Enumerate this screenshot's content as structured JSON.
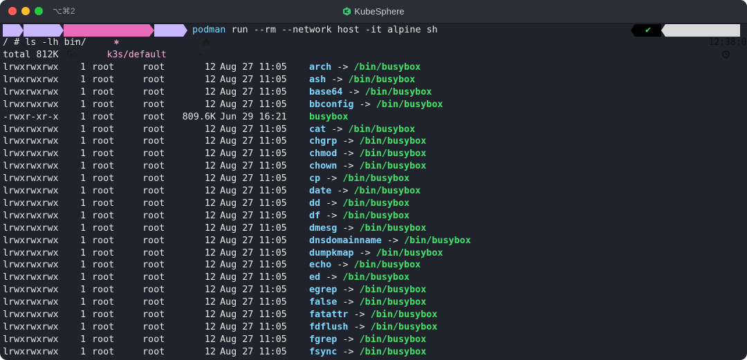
{
  "window": {
    "shortcut": "⌥⌘2",
    "title": "KubeSphere"
  },
  "prompt": {
    "apple_icon": "apple-icon",
    "go_label": "Go",
    "k8s_context": "k3s/default",
    "dir_label": "~",
    "command_bin": "podman",
    "command_args": "run --rm --network host -it alpine sh",
    "status": "✔",
    "time": "12:38:09"
  },
  "shell": {
    "line1": "/ # ls -lh bin/",
    "line2": "total 812K"
  },
  "listing": [
    {
      "perm": "lrwxrwxrwx",
      "links": "1",
      "owner": "root",
      "group": "root",
      "size": "12",
      "date": "Aug 27 11:05",
      "name": "arch",
      "target": "/bin/busybox"
    },
    {
      "perm": "lrwxrwxrwx",
      "links": "1",
      "owner": "root",
      "group": "root",
      "size": "12",
      "date": "Aug 27 11:05",
      "name": "ash",
      "target": "/bin/busybox"
    },
    {
      "perm": "lrwxrwxrwx",
      "links": "1",
      "owner": "root",
      "group": "root",
      "size": "12",
      "date": "Aug 27 11:05",
      "name": "base64",
      "target": "/bin/busybox"
    },
    {
      "perm": "lrwxrwxrwx",
      "links": "1",
      "owner": "root",
      "group": "root",
      "size": "12",
      "date": "Aug 27 11:05",
      "name": "bbconfig",
      "target": "/bin/busybox"
    },
    {
      "perm": "-rwxr-xr-x",
      "links": "1",
      "owner": "root",
      "group": "root",
      "size": "809.6K",
      "date": "Jun 29 16:21",
      "name": "busybox",
      "target": ""
    },
    {
      "perm": "lrwxrwxrwx",
      "links": "1",
      "owner": "root",
      "group": "root",
      "size": "12",
      "date": "Aug 27 11:05",
      "name": "cat",
      "target": "/bin/busybox"
    },
    {
      "perm": "lrwxrwxrwx",
      "links": "1",
      "owner": "root",
      "group": "root",
      "size": "12",
      "date": "Aug 27 11:05",
      "name": "chgrp",
      "target": "/bin/busybox"
    },
    {
      "perm": "lrwxrwxrwx",
      "links": "1",
      "owner": "root",
      "group": "root",
      "size": "12",
      "date": "Aug 27 11:05",
      "name": "chmod",
      "target": "/bin/busybox"
    },
    {
      "perm": "lrwxrwxrwx",
      "links": "1",
      "owner": "root",
      "group": "root",
      "size": "12",
      "date": "Aug 27 11:05",
      "name": "chown",
      "target": "/bin/busybox"
    },
    {
      "perm": "lrwxrwxrwx",
      "links": "1",
      "owner": "root",
      "group": "root",
      "size": "12",
      "date": "Aug 27 11:05",
      "name": "cp",
      "target": "/bin/busybox"
    },
    {
      "perm": "lrwxrwxrwx",
      "links": "1",
      "owner": "root",
      "group": "root",
      "size": "12",
      "date": "Aug 27 11:05",
      "name": "date",
      "target": "/bin/busybox"
    },
    {
      "perm": "lrwxrwxrwx",
      "links": "1",
      "owner": "root",
      "group": "root",
      "size": "12",
      "date": "Aug 27 11:05",
      "name": "dd",
      "target": "/bin/busybox"
    },
    {
      "perm": "lrwxrwxrwx",
      "links": "1",
      "owner": "root",
      "group": "root",
      "size": "12",
      "date": "Aug 27 11:05",
      "name": "df",
      "target": "/bin/busybox"
    },
    {
      "perm": "lrwxrwxrwx",
      "links": "1",
      "owner": "root",
      "group": "root",
      "size": "12",
      "date": "Aug 27 11:05",
      "name": "dmesg",
      "target": "/bin/busybox"
    },
    {
      "perm": "lrwxrwxrwx",
      "links": "1",
      "owner": "root",
      "group": "root",
      "size": "12",
      "date": "Aug 27 11:05",
      "name": "dnsdomainname",
      "target": "/bin/busybox"
    },
    {
      "perm": "lrwxrwxrwx",
      "links": "1",
      "owner": "root",
      "group": "root",
      "size": "12",
      "date": "Aug 27 11:05",
      "name": "dumpkmap",
      "target": "/bin/busybox"
    },
    {
      "perm": "lrwxrwxrwx",
      "links": "1",
      "owner": "root",
      "group": "root",
      "size": "12",
      "date": "Aug 27 11:05",
      "name": "echo",
      "target": "/bin/busybox"
    },
    {
      "perm": "lrwxrwxrwx",
      "links": "1",
      "owner": "root",
      "group": "root",
      "size": "12",
      "date": "Aug 27 11:05",
      "name": "ed",
      "target": "/bin/busybox"
    },
    {
      "perm": "lrwxrwxrwx",
      "links": "1",
      "owner": "root",
      "group": "root",
      "size": "12",
      "date": "Aug 27 11:05",
      "name": "egrep",
      "target": "/bin/busybox"
    },
    {
      "perm": "lrwxrwxrwx",
      "links": "1",
      "owner": "root",
      "group": "root",
      "size": "12",
      "date": "Aug 27 11:05",
      "name": "false",
      "target": "/bin/busybox"
    },
    {
      "perm": "lrwxrwxrwx",
      "links": "1",
      "owner": "root",
      "group": "root",
      "size": "12",
      "date": "Aug 27 11:05",
      "name": "fatattr",
      "target": "/bin/busybox"
    },
    {
      "perm": "lrwxrwxrwx",
      "links": "1",
      "owner": "root",
      "group": "root",
      "size": "12",
      "date": "Aug 27 11:05",
      "name": "fdflush",
      "target": "/bin/busybox"
    },
    {
      "perm": "lrwxrwxrwx",
      "links": "1",
      "owner": "root",
      "group": "root",
      "size": "12",
      "date": "Aug 27 11:05",
      "name": "fgrep",
      "target": "/bin/busybox"
    },
    {
      "perm": "lrwxrwxrwx",
      "links": "1",
      "owner": "root",
      "group": "root",
      "size": "12",
      "date": "Aug 27 11:05",
      "name": "fsync",
      "target": "/bin/busybox"
    }
  ],
  "link_arrow": "->",
  "colors": {
    "background": "#20232b",
    "filename": "#7fd7ff",
    "link_target": "#41e36a",
    "powerline_lilac": "#c8b6ff",
    "powerline_pink": "#e86bb8"
  }
}
